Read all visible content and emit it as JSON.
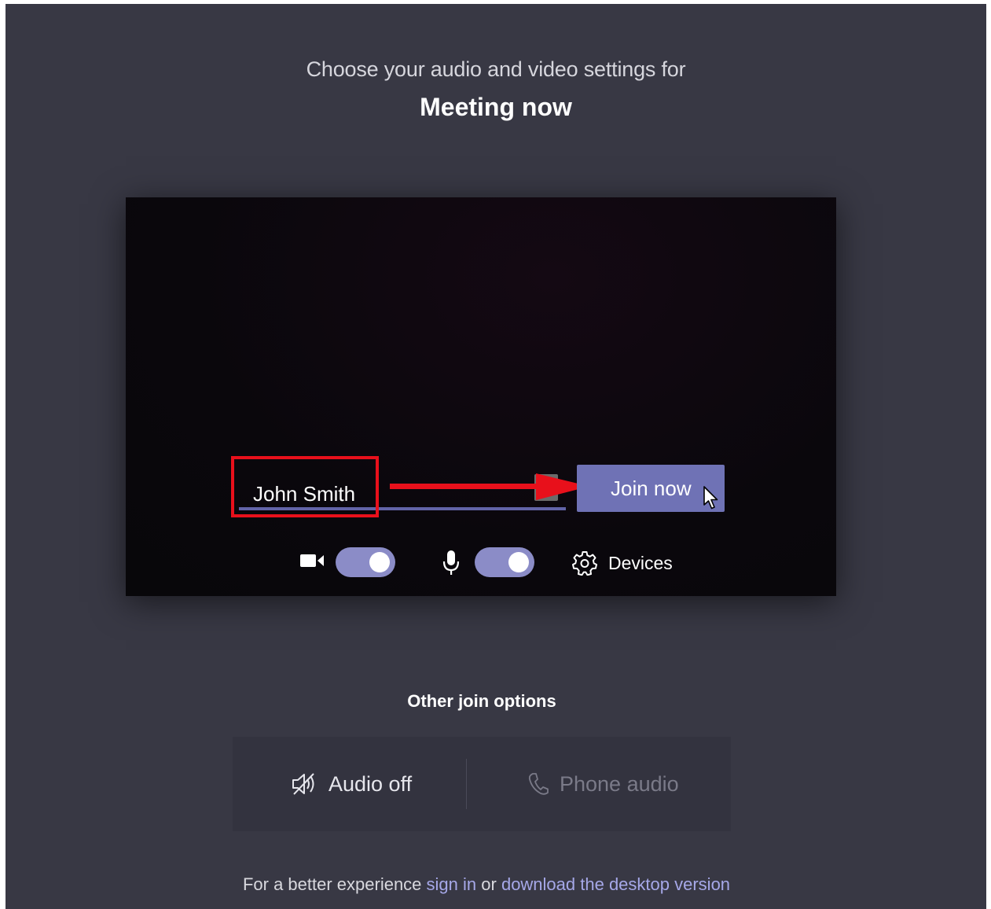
{
  "header": {
    "subtitle": "Choose your audio and video settings for",
    "meeting_title": "Meeting now"
  },
  "prejoin": {
    "name_value": "John Smith",
    "join_label": "Join now",
    "camera_toggle_on": true,
    "mic_toggle_on": true,
    "devices_label": "Devices"
  },
  "other_options": {
    "title": "Other join options",
    "audio_off_label": "Audio off",
    "phone_audio_label": "Phone audio"
  },
  "footer": {
    "prefix": "For a better experience",
    "sign_in": "sign in",
    "or": "or",
    "download": "download the desktop version"
  },
  "colors": {
    "background": "#383844",
    "accent": "#6264a7",
    "button": "#6f72b5",
    "annotation": "#e8101b",
    "link": "#a6a8e8"
  }
}
